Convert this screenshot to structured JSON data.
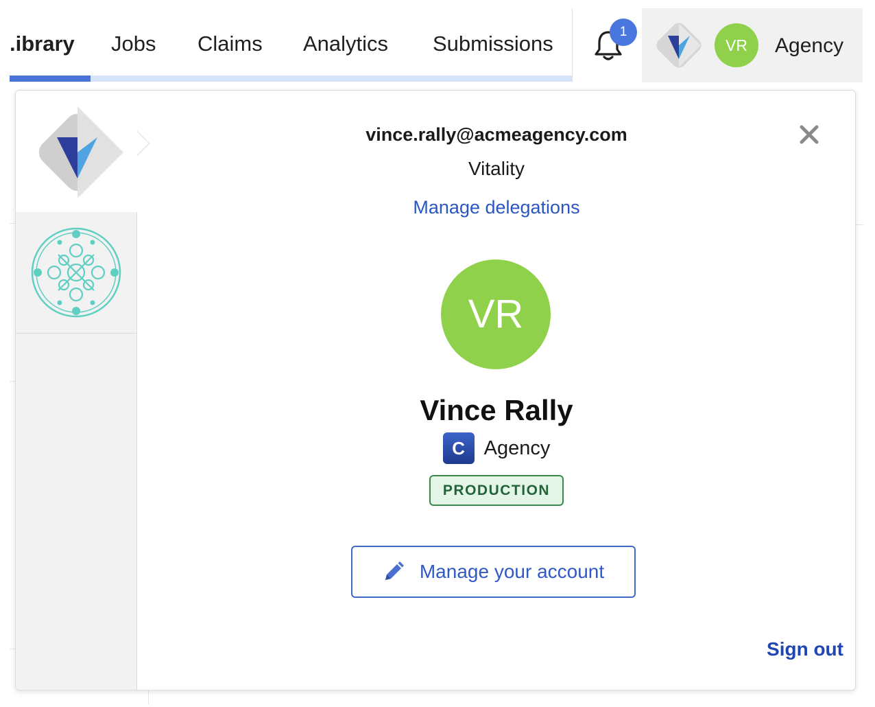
{
  "nav": {
    "tabs": [
      {
        "label": ".ibrary",
        "active": true
      },
      {
        "label": "Jobs",
        "active": false
      },
      {
        "label": "Claims",
        "active": false
      },
      {
        "label": "Analytics",
        "active": false
      },
      {
        "label": "Submissions",
        "active": false
      }
    ],
    "notifications": {
      "icon": "bell-icon",
      "count": "1"
    },
    "account": {
      "avatar_initials": "VR",
      "label": "Agency",
      "logo": "vitality-logo"
    }
  },
  "popover": {
    "email": "vince.rally@acmeagency.com",
    "organization": "Vitality",
    "manage_delegations": "Manage delegations",
    "close_icon": "close-icon",
    "avatar_initials": "VR",
    "user_name": "Vince Rally",
    "agency_badge_letter": "C",
    "agency_name": "Agency",
    "environment": "PRODUCTION",
    "manage_account": "Manage your account",
    "manage_account_icon": "pencil-icon",
    "sign_out": "Sign out",
    "org_rail": [
      {
        "name": "vitality-logo",
        "selected": true
      },
      {
        "name": "ornament-logo",
        "selected": false
      }
    ]
  },
  "colors": {
    "accent_blue": "#4a75d6",
    "link_blue": "#2a56c4",
    "avatar_green": "#8fd14a",
    "production_green": "#3a8a4e",
    "badge_blue": "#4a77de"
  }
}
